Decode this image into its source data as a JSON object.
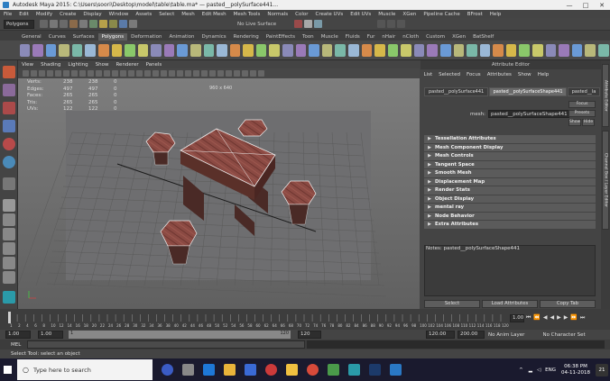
{
  "window": {
    "title": "Autodesk Maya 2015: C:\\Users\\soori\\Desktop\\model\\table\\table.ma* — pasted__polySurface441...",
    "controls": [
      "—",
      "□",
      "✕"
    ]
  },
  "main_menu": [
    "File",
    "Edit",
    "Modify",
    "Create",
    "Display",
    "Window",
    "Assets",
    "Select",
    "Mesh",
    "Edit Mesh",
    "Mesh Tools",
    "Normals",
    "Color",
    "Create UVs",
    "Edit UVs",
    "MuscIe",
    "XGen",
    "Pipeline Cache",
    "BFrost",
    "Help"
  ],
  "status_line": {
    "mode": "Polygons",
    "live": "No Live Surface"
  },
  "shelf_tabs": [
    "General",
    "Curves",
    "Surfaces",
    "Polygons",
    "Deformation",
    "Animation",
    "Dynamics",
    "Rendering",
    "PaintEffects",
    "Toon",
    "Muscle",
    "Fluids",
    "Fur",
    "nHair",
    "nCloth",
    "Custom",
    "XGen",
    "BatShelf"
  ],
  "active_shelf_tab": "Polygons",
  "viewport": {
    "menu": [
      "View",
      "Shading",
      "Lighting",
      "Show",
      "Renderer",
      "Panels"
    ],
    "resolution": "960 x 640",
    "hud": [
      {
        "k": "Verts:",
        "a": "238",
        "b": "238",
        "c": "0"
      },
      {
        "k": "Edges:",
        "a": "497",
        "b": "497",
        "c": "0"
      },
      {
        "k": "Faces:",
        "a": "265",
        "b": "265",
        "c": "0"
      },
      {
        "k": "Tris:",
        "a": "265",
        "b": "265",
        "c": "0"
      },
      {
        "k": "UVs:",
        "a": "122",
        "b": "122",
        "c": "0"
      }
    ]
  },
  "attribute_editor": {
    "title": "Attribute Editor",
    "menu": [
      "List",
      "Selected",
      "Focus",
      "Attributes",
      "Show",
      "Help"
    ],
    "tabs": [
      "pasted__polySurface441",
      "pasted__polySurfaceShape441",
      "pasted__la"
    ],
    "active_tab": 1,
    "node_label": "mesh:",
    "node_value": "pasted__polySurfaceShape441",
    "focus": "Focus",
    "presets": "Presets",
    "show": "Show",
    "hide": "Hide",
    "sections": [
      "Tessellation Attributes",
      "Mesh Component Display",
      "Mesh Controls",
      "Tangent Space",
      "Smooth Mesh",
      "Displacement Map",
      "Render Stats",
      "Object Display",
      "mental ray",
      "Node Behavior",
      "Extra Attributes"
    ],
    "notes": "Notes:  pasted__polySurfaceShape441",
    "buttons": [
      "Select",
      "Load Attributes",
      "Copy Tab"
    ]
  },
  "side_tabs": [
    "Attribute Editor",
    "Channel Box / Layer Editor"
  ],
  "timeline": {
    "ticks": [
      "1",
      "2",
      "4",
      "6",
      "8",
      "10",
      "12",
      "14",
      "16",
      "18",
      "20",
      "22",
      "24",
      "26",
      "28",
      "30",
      "32",
      "34",
      "36",
      "38",
      "40",
      "42",
      "44",
      "46",
      "48",
      "50",
      "52",
      "54",
      "56",
      "58",
      "60",
      "62",
      "64",
      "66",
      "68",
      "70",
      "72",
      "74",
      "76",
      "78",
      "80",
      "82",
      "84",
      "86",
      "88",
      "90",
      "92",
      "94",
      "96",
      "98",
      "100",
      "102",
      "104",
      "106",
      "108",
      "110",
      "112",
      "114",
      "116",
      "118",
      "120"
    ],
    "current": "1.00"
  },
  "range": {
    "start": "1.00",
    "start2": "1.00",
    "mid": "1",
    "end": "120",
    "end2": "120.00",
    "max": "200.00",
    "anim_layer": "No Anim Layer",
    "char_set": "No Character Set"
  },
  "mel": {
    "label": "MEL"
  },
  "help_line": "Select Tool: select an object",
  "taskbar": {
    "search": "Type here to search",
    "lang": "ENG",
    "time": "06:38 PM",
    "date": "04-11-2018",
    "notif": "21"
  },
  "colors": {
    "accent": "#5d87b8",
    "wood": "#8b4a43",
    "viewport_top": "#7d7d7d",
    "viewport_bottom": "#606060"
  }
}
